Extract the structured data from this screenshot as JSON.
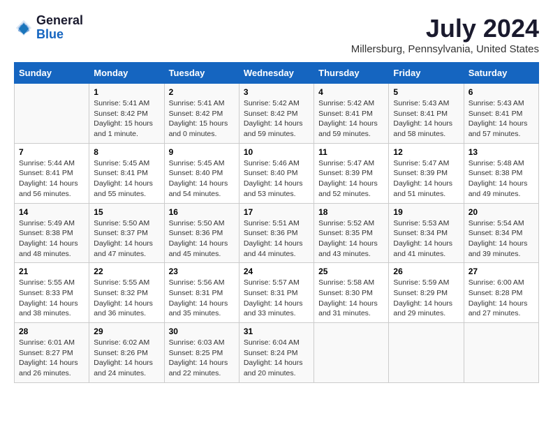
{
  "header": {
    "logo": {
      "general": "General",
      "blue": "Blue"
    },
    "title": "July 2024",
    "subtitle": "Millersburg, Pennsylvania, United States"
  },
  "columns": [
    "Sunday",
    "Monday",
    "Tuesday",
    "Wednesday",
    "Thursday",
    "Friday",
    "Saturday"
  ],
  "weeks": [
    [
      {
        "day": "",
        "sunrise": "",
        "sunset": "",
        "daylight": ""
      },
      {
        "day": "1",
        "sunrise": "Sunrise: 5:41 AM",
        "sunset": "Sunset: 8:42 PM",
        "daylight": "Daylight: 15 hours and 1 minute."
      },
      {
        "day": "2",
        "sunrise": "Sunrise: 5:41 AM",
        "sunset": "Sunset: 8:42 PM",
        "daylight": "Daylight: 15 hours and 0 minutes."
      },
      {
        "day": "3",
        "sunrise": "Sunrise: 5:42 AM",
        "sunset": "Sunset: 8:42 PM",
        "daylight": "Daylight: 14 hours and 59 minutes."
      },
      {
        "day": "4",
        "sunrise": "Sunrise: 5:42 AM",
        "sunset": "Sunset: 8:41 PM",
        "daylight": "Daylight: 14 hours and 59 minutes."
      },
      {
        "day": "5",
        "sunrise": "Sunrise: 5:43 AM",
        "sunset": "Sunset: 8:41 PM",
        "daylight": "Daylight: 14 hours and 58 minutes."
      },
      {
        "day": "6",
        "sunrise": "Sunrise: 5:43 AM",
        "sunset": "Sunset: 8:41 PM",
        "daylight": "Daylight: 14 hours and 57 minutes."
      }
    ],
    [
      {
        "day": "7",
        "sunrise": "Sunrise: 5:44 AM",
        "sunset": "Sunset: 8:41 PM",
        "daylight": "Daylight: 14 hours and 56 minutes."
      },
      {
        "day": "8",
        "sunrise": "Sunrise: 5:45 AM",
        "sunset": "Sunset: 8:41 PM",
        "daylight": "Daylight: 14 hours and 55 minutes."
      },
      {
        "day": "9",
        "sunrise": "Sunrise: 5:45 AM",
        "sunset": "Sunset: 8:40 PM",
        "daylight": "Daylight: 14 hours and 54 minutes."
      },
      {
        "day": "10",
        "sunrise": "Sunrise: 5:46 AM",
        "sunset": "Sunset: 8:40 PM",
        "daylight": "Daylight: 14 hours and 53 minutes."
      },
      {
        "day": "11",
        "sunrise": "Sunrise: 5:47 AM",
        "sunset": "Sunset: 8:39 PM",
        "daylight": "Daylight: 14 hours and 52 minutes."
      },
      {
        "day": "12",
        "sunrise": "Sunrise: 5:47 AM",
        "sunset": "Sunset: 8:39 PM",
        "daylight": "Daylight: 14 hours and 51 minutes."
      },
      {
        "day": "13",
        "sunrise": "Sunrise: 5:48 AM",
        "sunset": "Sunset: 8:38 PM",
        "daylight": "Daylight: 14 hours and 49 minutes."
      }
    ],
    [
      {
        "day": "14",
        "sunrise": "Sunrise: 5:49 AM",
        "sunset": "Sunset: 8:38 PM",
        "daylight": "Daylight: 14 hours and 48 minutes."
      },
      {
        "day": "15",
        "sunrise": "Sunrise: 5:50 AM",
        "sunset": "Sunset: 8:37 PM",
        "daylight": "Daylight: 14 hours and 47 minutes."
      },
      {
        "day": "16",
        "sunrise": "Sunrise: 5:50 AM",
        "sunset": "Sunset: 8:36 PM",
        "daylight": "Daylight: 14 hours and 45 minutes."
      },
      {
        "day": "17",
        "sunrise": "Sunrise: 5:51 AM",
        "sunset": "Sunset: 8:36 PM",
        "daylight": "Daylight: 14 hours and 44 minutes."
      },
      {
        "day": "18",
        "sunrise": "Sunrise: 5:52 AM",
        "sunset": "Sunset: 8:35 PM",
        "daylight": "Daylight: 14 hours and 43 minutes."
      },
      {
        "day": "19",
        "sunrise": "Sunrise: 5:53 AM",
        "sunset": "Sunset: 8:34 PM",
        "daylight": "Daylight: 14 hours and 41 minutes."
      },
      {
        "day": "20",
        "sunrise": "Sunrise: 5:54 AM",
        "sunset": "Sunset: 8:34 PM",
        "daylight": "Daylight: 14 hours and 39 minutes."
      }
    ],
    [
      {
        "day": "21",
        "sunrise": "Sunrise: 5:55 AM",
        "sunset": "Sunset: 8:33 PM",
        "daylight": "Daylight: 14 hours and 38 minutes."
      },
      {
        "day": "22",
        "sunrise": "Sunrise: 5:55 AM",
        "sunset": "Sunset: 8:32 PM",
        "daylight": "Daylight: 14 hours and 36 minutes."
      },
      {
        "day": "23",
        "sunrise": "Sunrise: 5:56 AM",
        "sunset": "Sunset: 8:31 PM",
        "daylight": "Daylight: 14 hours and 35 minutes."
      },
      {
        "day": "24",
        "sunrise": "Sunrise: 5:57 AM",
        "sunset": "Sunset: 8:31 PM",
        "daylight": "Daylight: 14 hours and 33 minutes."
      },
      {
        "day": "25",
        "sunrise": "Sunrise: 5:58 AM",
        "sunset": "Sunset: 8:30 PM",
        "daylight": "Daylight: 14 hours and 31 minutes."
      },
      {
        "day": "26",
        "sunrise": "Sunrise: 5:59 AM",
        "sunset": "Sunset: 8:29 PM",
        "daylight": "Daylight: 14 hours and 29 minutes."
      },
      {
        "day": "27",
        "sunrise": "Sunrise: 6:00 AM",
        "sunset": "Sunset: 8:28 PM",
        "daylight": "Daylight: 14 hours and 27 minutes."
      }
    ],
    [
      {
        "day": "28",
        "sunrise": "Sunrise: 6:01 AM",
        "sunset": "Sunset: 8:27 PM",
        "daylight": "Daylight: 14 hours and 26 minutes."
      },
      {
        "day": "29",
        "sunrise": "Sunrise: 6:02 AM",
        "sunset": "Sunset: 8:26 PM",
        "daylight": "Daylight: 14 hours and 24 minutes."
      },
      {
        "day": "30",
        "sunrise": "Sunrise: 6:03 AM",
        "sunset": "Sunset: 8:25 PM",
        "daylight": "Daylight: 14 hours and 22 minutes."
      },
      {
        "day": "31",
        "sunrise": "Sunrise: 6:04 AM",
        "sunset": "Sunset: 8:24 PM",
        "daylight": "Daylight: 14 hours and 20 minutes."
      },
      {
        "day": "",
        "sunrise": "",
        "sunset": "",
        "daylight": ""
      },
      {
        "day": "",
        "sunrise": "",
        "sunset": "",
        "daylight": ""
      },
      {
        "day": "",
        "sunrise": "",
        "sunset": "",
        "daylight": ""
      }
    ]
  ]
}
